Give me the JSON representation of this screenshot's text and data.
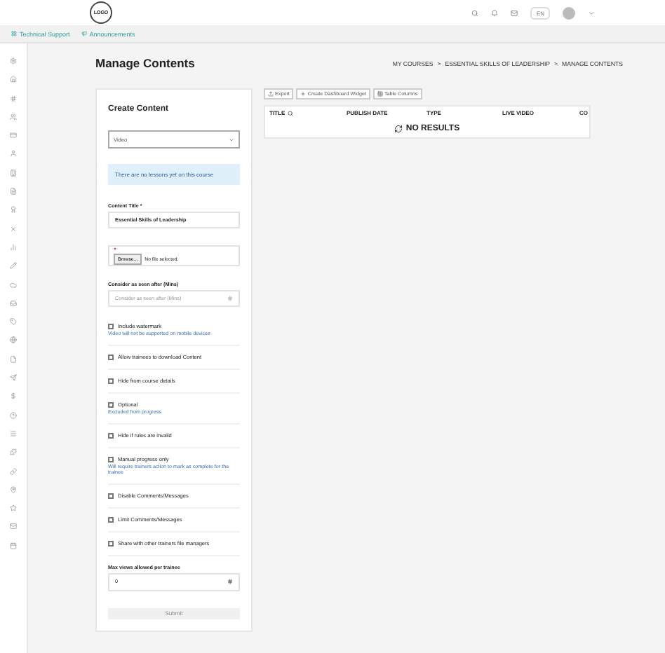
{
  "header": {
    "logo": "LOGO",
    "language": "EN"
  },
  "subnav": [
    {
      "label": "Technical Support"
    },
    {
      "label": "Announcements"
    }
  ],
  "page": {
    "title": "Manage Contents",
    "breadcrumb": [
      "MY COURSES",
      ">",
      "ESSENTIAL SKILLS OF LEADERSHIP",
      ">",
      "MANAGE CONTENTS"
    ]
  },
  "form": {
    "title": "Create Content",
    "type_select": {
      "value": "Video"
    },
    "notice": "There are no lessons yet on this course",
    "content_title": {
      "label": "Content Title *",
      "value": "Essential Skills of Leadership"
    },
    "file": {
      "marker": "*",
      "button": "Browse...",
      "status": "No file selected."
    },
    "consider_seen": {
      "label": "Consider as seen after (Mins)",
      "placeholder": "Consider as seen after (Mins)"
    },
    "options": [
      {
        "label": "Include watermark",
        "checked": false,
        "hint": "Video will not be supported on mobile devices"
      },
      {
        "label": "Allow trainees to download Content",
        "checked": false
      },
      {
        "label": "Hide from course details",
        "checked": false
      },
      {
        "label": "Optional",
        "checked": false,
        "hint": "Excluded from progress"
      },
      {
        "label": "Hide if rules are invalid",
        "checked": false
      },
      {
        "label": "Manual progress only",
        "checked": false,
        "hint": "Will require trainers action to mark as complete for the trainee"
      },
      {
        "label": "Disable Comments/Messages",
        "checked": false
      },
      {
        "label": "Limit Comments/Messages",
        "checked": false
      },
      {
        "label": "Share with other trainers file managers",
        "checked": false
      }
    ],
    "max_views": {
      "label": "Max views allowed per trainee",
      "value": "0"
    },
    "submit": {
      "label": "Submit",
      "disabled": true
    }
  },
  "table": {
    "toolbar": [
      {
        "label": "Export"
      },
      {
        "label": "Create Dashboard Widget"
      },
      {
        "label": "Table Columns"
      }
    ],
    "columns": [
      "TITLE",
      "PUBLISH DATE",
      "TYPE",
      "LIVE VIDEO",
      "CO"
    ],
    "empty": "NO RESULTS"
  }
}
